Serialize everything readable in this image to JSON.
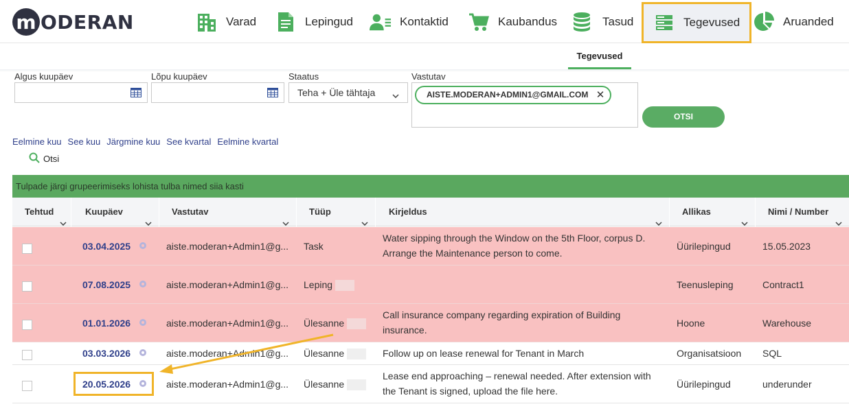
{
  "brand": {
    "logo_letter": "m",
    "logo_text": "ODERAN"
  },
  "nav": [
    {
      "label": "Varad",
      "icon": "building-icon"
    },
    {
      "label": "Lepingud",
      "icon": "document-icon"
    },
    {
      "label": "Kontaktid",
      "icon": "contacts-icon"
    },
    {
      "label": "Kaubandus",
      "icon": "cart-icon"
    },
    {
      "label": "Tasud",
      "icon": "coins-icon"
    },
    {
      "label": "Tegevused",
      "icon": "server-icon",
      "active": true
    },
    {
      "label": "Aruanded",
      "icon": "pie-chart-icon"
    }
  ],
  "subnav": {
    "active_tab": "Tegevused"
  },
  "filters": {
    "start_label": "Algus kuupäev",
    "end_label": "Lõpu kuupäev",
    "status_label": "Staatus",
    "status_value": "Teha + Üle tähtaja",
    "assignee_label": "Vastutav",
    "assignee_chip": "AISTE.MODERAN+ADMIN1@GMAIL.COM",
    "search_button": "OTSI"
  },
  "quick_links": [
    "Eelmine kuu",
    "See kuu",
    "Järgmine kuu",
    "See kvartal",
    "Eelmine kvartal"
  ],
  "search_link": "Otsi",
  "group_bar": "Tulpade järgi grupeerimiseks lohista tulba nimed siia kasti",
  "table": {
    "columns": [
      "Tehtud",
      "Kuupäev",
      "Vastutav",
      "Tüüp",
      "Kirjeldus",
      "Allikas",
      "Nimi / Number"
    ],
    "rows": [
      {
        "date": "03.04.2025",
        "assignee": "aiste.moderan+Admin1@g...",
        "type": "Task",
        "desc1": "Water sipping through the Window on the 5th Floor, corpus D.",
        "desc2": "Arrange the Maintenance person to come.",
        "source": "Üürilepingud",
        "name": "15.05.2023",
        "overdue": true
      },
      {
        "date": "07.08.2025",
        "assignee": "aiste.moderan+Admin1@g...",
        "type": "Leping",
        "desc1": "",
        "desc2": "",
        "source": "Teenusleping",
        "name": "Contract1",
        "overdue": true
      },
      {
        "date": "01.01.2026",
        "assignee": "aiste.moderan+Admin1@g...",
        "type": "Ülesanne",
        "desc1": "Call insurance company regarding expiration of Building",
        "desc2": "insurance.",
        "source": "Hoone",
        "name": "Warehouse",
        "overdue": true
      },
      {
        "date": "03.03.2026",
        "assignee": "aiste.moderan+Admin1@g...",
        "type": "Ülesanne",
        "desc1": "Follow up on lease renewal for Tenant in March",
        "desc2": "",
        "source": "Organisatsioon",
        "name": "SQL",
        "overdue": false
      },
      {
        "date": "20.05.2026",
        "assignee": "aiste.moderan+Admin1@g...",
        "type": "Ülesanne",
        "desc1": "Lease end approaching – renewal needed. After extension with",
        "desc2": "the Tenant is signed, upload the file here.",
        "source": "Üürilepingud",
        "name": "underunder",
        "overdue": false
      }
    ]
  },
  "colors": {
    "green": "#5aac64",
    "overdue_row": "#f9c1c1",
    "highlight": "#f0b429",
    "link": "#2f3f8a"
  }
}
